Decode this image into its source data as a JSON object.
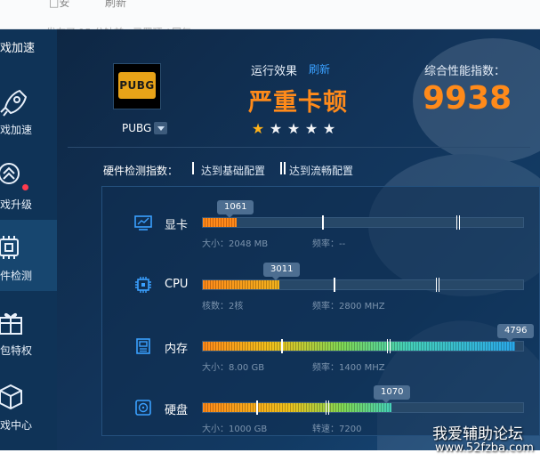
{
  "topbar": {
    "frag1": "□安",
    "frag2": "刷新",
    "frag3": "发布了 15 分钟前 · 已置顶 / 回复",
    "frag4": "回复"
  },
  "sidebar": {
    "title": "戏加速",
    "items": [
      {
        "label": "戏加速",
        "icon": "rocket-icon"
      },
      {
        "label": "戏升级",
        "icon": "upgrade-icon"
      },
      {
        "label": "件检测",
        "icon": "chip-icon"
      },
      {
        "label": "包特权",
        "icon": "gift-icon"
      },
      {
        "label": "戏中心",
        "icon": "cube-icon"
      }
    ]
  },
  "game": {
    "logo_text": "PUBG",
    "name": "PUBG"
  },
  "effect": {
    "label": "运行效果",
    "refresh": "刷新",
    "status": "严重卡顿",
    "stars_filled": 1,
    "stars_total": 5
  },
  "score": {
    "label": "综合性能指数：",
    "value": "9938"
  },
  "hw": {
    "title": "硬件检测指数：",
    "legend_basic": "达到基础配置",
    "legend_smooth": "达到流畅配置",
    "rows": [
      {
        "name": "显卡",
        "icon": "gpu-icon",
        "score": "1061",
        "fill": 0.105,
        "sub1": "大小：2048 MB",
        "sub2": "频率：--",
        "gradient": "orange"
      },
      {
        "name": "CPU",
        "icon": "cpu-icon",
        "score": "3011",
        "fill": 0.24,
        "sub1": "核数：2核",
        "sub2": "频率：2800 MHZ",
        "gradient": "orange-yellow"
      },
      {
        "name": "内存",
        "icon": "memory-icon",
        "score": "4796",
        "fill": 0.975,
        "sub1": "大小：8.00 GB",
        "sub2": "频率：1400 MHZ",
        "gradient": "full"
      },
      {
        "name": "硬盘",
        "icon": "disk-icon",
        "score": "1070",
        "fill": 0.59,
        "sub1": "大小：1000 GB",
        "sub2": "转速：7200",
        "gradient": "mid"
      }
    ]
  },
  "colors": {
    "accent": "#ff8a1a",
    "link": "#3aa0ff",
    "sidebar": "#0f3357",
    "main_bg": "#12345a"
  },
  "watermark": {
    "line1": "我爱辅助论坛",
    "line2": "www.52fzba.com"
  }
}
